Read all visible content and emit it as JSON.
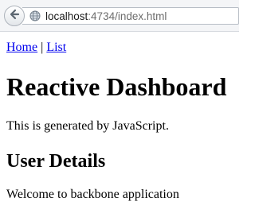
{
  "browser": {
    "url_host": "localhost",
    "url_rest": ":4734/index.html"
  },
  "nav": {
    "home_label": "Home",
    "separator": "|",
    "list_label": "List"
  },
  "content": {
    "title": "Reactive Dashboard",
    "generated_text": "This is generated by JavaScript.",
    "section_heading": "User Details",
    "welcome_text": "Welcome to backbone application"
  }
}
